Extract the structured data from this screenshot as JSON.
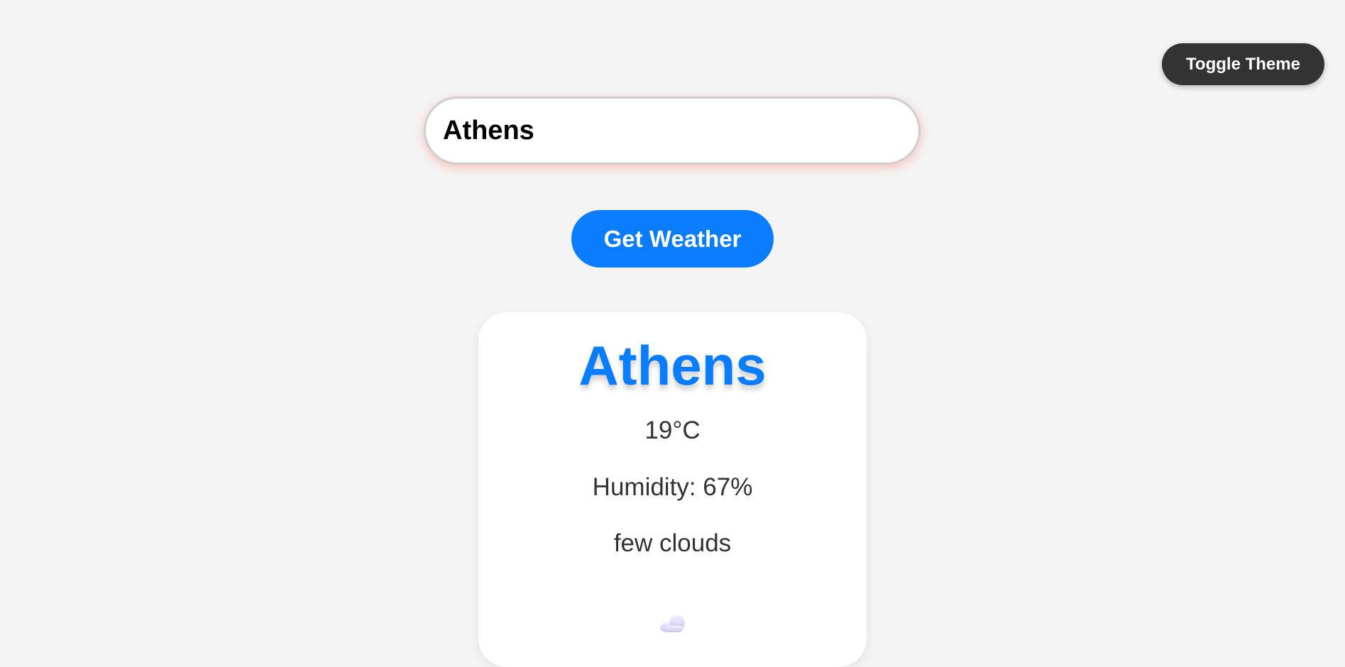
{
  "header": {
    "toggle_theme_label": "Toggle Theme"
  },
  "search": {
    "value": "Athens",
    "button_label": "Get Weather"
  },
  "weather": {
    "city": "Athens",
    "temperature": "19°C",
    "humidity": "Humidity: 67%",
    "description": "few clouds",
    "icon": "few-clouds-icon"
  },
  "colors": {
    "accent": "#0a7cff",
    "background": "#f4f4f4",
    "toggle_button": "#333333",
    "text": "#333333"
  }
}
